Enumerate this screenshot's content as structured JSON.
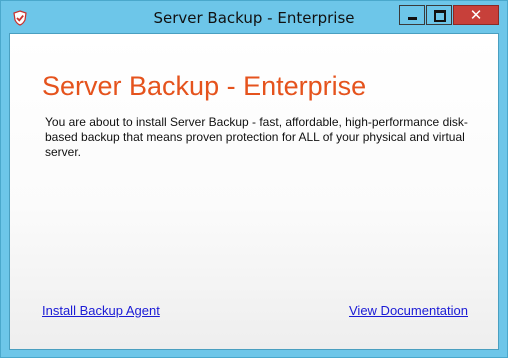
{
  "window": {
    "title": "Server Backup - Enterprise",
    "close_glyph": "✕"
  },
  "main": {
    "heading": "Server Backup - Enterprise",
    "description": "You are about to install Server Backup - fast, affordable, high-performance disk-based backup that means proven protection for ALL of your physical and virtual server.",
    "links": {
      "install": "Install Backup Agent",
      "documentation": "View Documentation"
    }
  },
  "icons": {
    "app": "shield-check-icon",
    "minimize": "minimize-icon",
    "maximize": "maximize-icon",
    "close": "close-icon"
  },
  "colors": {
    "titlebar": "#6dc6e9",
    "heading": "#e5531d",
    "link": "#1b1bd6",
    "close_button": "#c7403a"
  }
}
